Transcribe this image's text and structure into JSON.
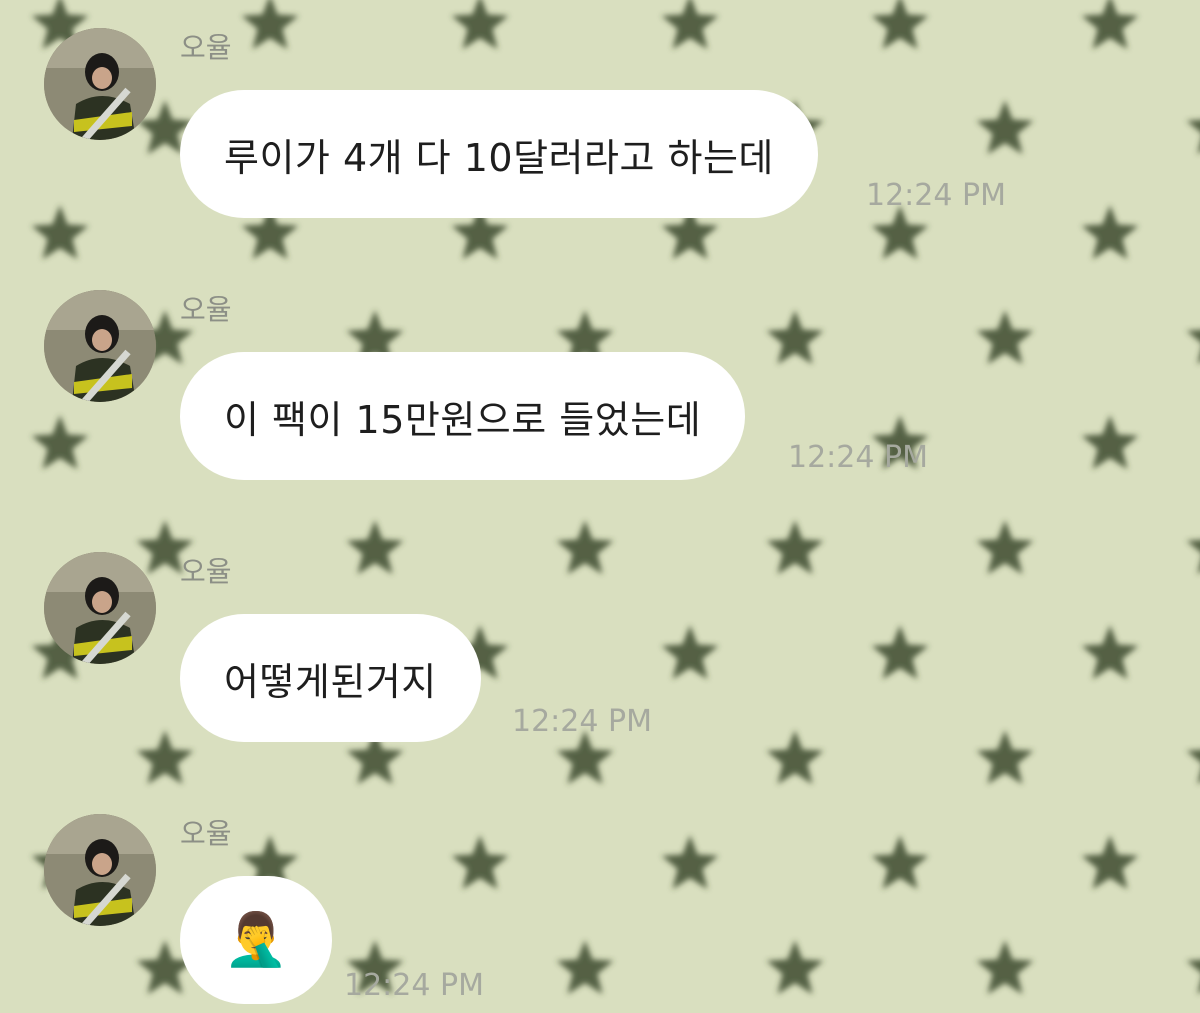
{
  "chat": {
    "background": {
      "base_color": "#d9dfbf",
      "pattern": "star-icon",
      "pattern_color": "#3d4a2d"
    },
    "bubble_color": "#ffffff",
    "messages": [
      {
        "sender": "오율",
        "avatar": "avatar-photo",
        "text": "루이가 4개 다 10달러라고 하는데",
        "time": "12:24 PM"
      },
      {
        "sender": "오율",
        "avatar": "avatar-photo",
        "text": "이 팩이 15만원으로 들었는데",
        "time": "12:24 PM"
      },
      {
        "sender": "오율",
        "avatar": "avatar-photo",
        "text": "어떻게된거지",
        "time": "12:24 PM"
      },
      {
        "sender": "오율",
        "avatar": "avatar-photo",
        "text": "🤦‍♂️",
        "time": "12:24 PM"
      }
    ]
  }
}
